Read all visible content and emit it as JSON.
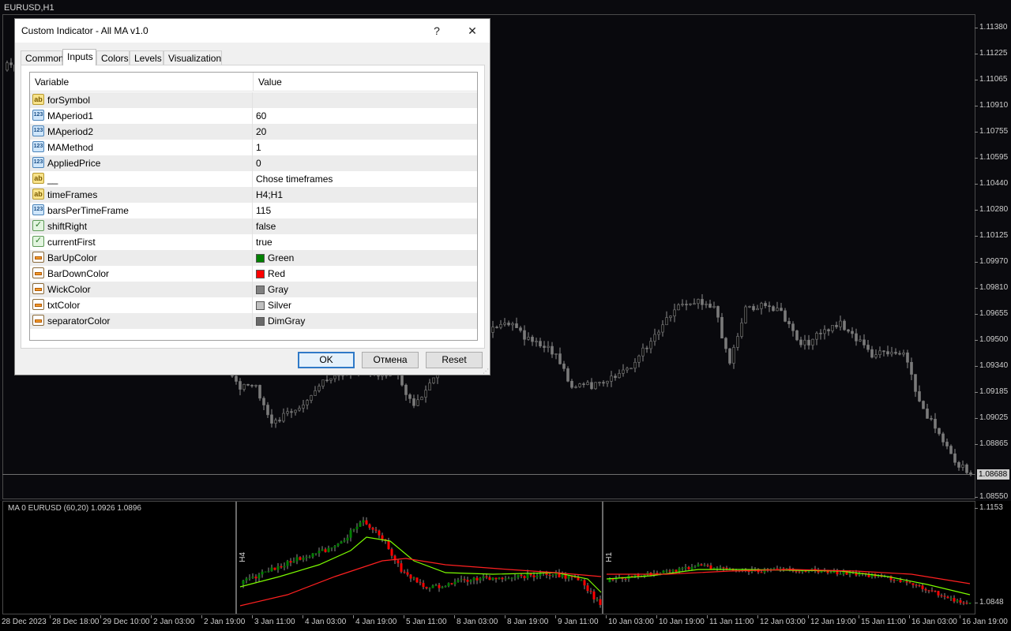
{
  "chart": {
    "title": "EURUSD,H1",
    "current_price": "1.08688",
    "price_ticks": [
      "1.11380",
      "1.11225",
      "1.11065",
      "1.10910",
      "1.10755",
      "1.10595",
      "1.10440",
      "1.10280",
      "1.10125",
      "1.09970",
      "1.09810",
      "1.09655",
      "1.09500",
      "1.09340",
      "1.09185",
      "1.09025",
      "1.08865",
      "1.08550"
    ],
    "sub_price_ticks": [
      "1.1153",
      "1.0848"
    ],
    "sub_title": "MA 0 EURUSD (60,20) 1.0926 1.0896",
    "tf_labels": [
      "H4",
      "H1"
    ],
    "time_labels": [
      "28 Dec 2023",
      "28 Dec 18:00",
      "29 Dec 10:00",
      "2 Jan 03:00",
      "2 Jan 19:00",
      "3 Jan 11:00",
      "4 Jan 03:00",
      "4 Jan 19:00",
      "5 Jan 11:00",
      "8 Jan 03:00",
      "8 Jan 19:00",
      "9 Jan 11:00",
      "10 Jan 03:00",
      "10 Jan 19:00",
      "11 Jan 11:00",
      "12 Jan 03:00",
      "12 Jan 19:00",
      "15 Jan 11:00",
      "16 Jan 03:00",
      "16 Jan 19:00"
    ],
    "colors": {
      "bull": "#008000",
      "bear": "#ff0000",
      "wick": "#808080",
      "ma_fast": "#7CFC00",
      "ma_slow": "#ff2020"
    }
  },
  "dialog": {
    "title": "Custom Indicator - All MA v1.0",
    "help_label": "?",
    "close_label": "✕",
    "tabs": [
      "Common",
      "Inputs",
      "Colors",
      "Levels",
      "Visualization"
    ],
    "active_tab": "Inputs",
    "columns": [
      "Variable",
      "Value"
    ],
    "rows": [
      {
        "icon": "string-type-icon",
        "name": "forSymbol",
        "value": ""
      },
      {
        "icon": "number-type-icon",
        "name": "MAperiod1",
        "value": "60"
      },
      {
        "icon": "number-type-icon",
        "name": "MAperiod2",
        "value": "20"
      },
      {
        "icon": "number-type-icon",
        "name": "MAMethod",
        "value": "1"
      },
      {
        "icon": "number-type-icon",
        "name": "AppliedPrice",
        "value": "0"
      },
      {
        "icon": "string-type-icon",
        "name": "__",
        "value": "Chose timeframes"
      },
      {
        "icon": "string-type-icon",
        "name": "timeFrames",
        "value": "H4;H1"
      },
      {
        "icon": "number-type-icon",
        "name": "barsPerTimeFrame",
        "value": "115"
      },
      {
        "icon": "bool-type-icon",
        "name": "shiftRight",
        "value": "false"
      },
      {
        "icon": "bool-type-icon",
        "name": "currentFirst",
        "value": "true"
      },
      {
        "icon": "color-type-icon",
        "name": "BarUpColor",
        "value": "Green",
        "swatch": "#008000"
      },
      {
        "icon": "color-type-icon",
        "name": "BarDownColor",
        "value": "Red",
        "swatch": "#ff0000"
      },
      {
        "icon": "color-type-icon",
        "name": "WickColor",
        "value": "Gray",
        "swatch": "#808080"
      },
      {
        "icon": "color-type-icon",
        "name": "txtColor",
        "value": "Silver",
        "swatch": "#c0c0c0"
      },
      {
        "icon": "color-type-icon",
        "name": "separatorColor",
        "value": "DimGray",
        "swatch": "#696969"
      }
    ],
    "buttons": {
      "ok": "OK",
      "cancel": "Отмена",
      "reset": "Reset"
    },
    "icon_glyphs": {
      "string-type-icon": "ab",
      "number-type-icon": "123",
      "bool-type-icon": "✓"
    }
  }
}
